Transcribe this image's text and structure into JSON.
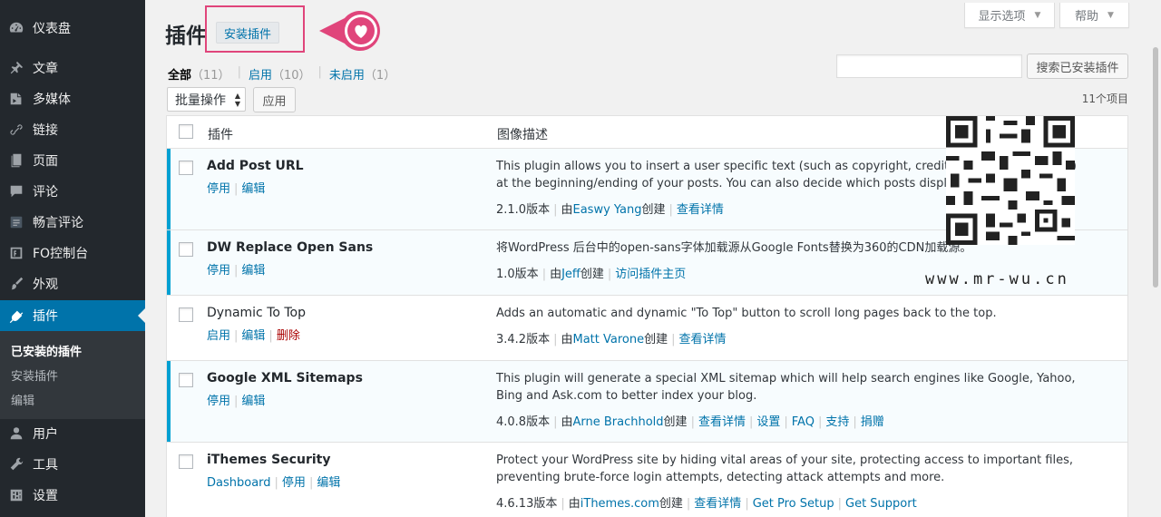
{
  "sidebar": {
    "items": [
      {
        "label": "仪表盘",
        "icon": "dashboard-icon"
      },
      {
        "label": "文章",
        "icon": "pin-icon"
      },
      {
        "label": "多媒体",
        "icon": "media-icon"
      },
      {
        "label": "链接",
        "icon": "link-icon"
      },
      {
        "label": "页面",
        "icon": "page-icon"
      },
      {
        "label": "评论",
        "icon": "comment-icon"
      },
      {
        "label": "畅言评论",
        "icon": "changyan-icon"
      },
      {
        "label": "FO控制台",
        "icon": "fo-console-icon"
      },
      {
        "label": "外观",
        "icon": "brush-icon"
      },
      {
        "label": "插件",
        "icon": "plugin-icon"
      },
      {
        "label": "用户",
        "icon": "user-icon"
      },
      {
        "label": "工具",
        "icon": "wrench-icon"
      },
      {
        "label": "设置",
        "icon": "settings-icon"
      }
    ],
    "submenu": [
      "已安装的插件",
      "安装插件",
      "编辑"
    ]
  },
  "header": {
    "title": "插件",
    "add_new": "安装插件",
    "screen_options": "显示选项",
    "help": "帮助"
  },
  "filters": {
    "all": "全部",
    "all_count": "（11）",
    "active": "启用",
    "active_count": "（10）",
    "inactive": "未启用",
    "inactive_count": "（1）"
  },
  "search": {
    "placeholder": "",
    "button": "搜索已安装插件"
  },
  "bulk": {
    "select": "批量操作",
    "apply": "应用",
    "count": "11个项目"
  },
  "table": {
    "col_plugin": "插件",
    "col_desc": "图像描述",
    "rows": [
      {
        "name": "Add Post URL",
        "actions": [
          "停用",
          "编辑"
        ],
        "desc": "This plugin allows you to insert a user specific text (such as copyright, credit, advertisement, etc.) at the beginning/ending of your posts. You can also decide which posts display the specific text.",
        "version": "2.1.0版本",
        "by": "由",
        "author": "Easwy Yang",
        "created": "创建",
        "links": [
          "查看详情"
        ]
      },
      {
        "name": "DW Replace Open Sans",
        "actions": [
          "停用",
          "编辑"
        ],
        "desc": "将WordPress 后台中的open-sans字体加载源从Google Fonts替换为360的CDN加载源。",
        "version": "1.0版本",
        "by": "由",
        "author": "Jeff",
        "created": "创建",
        "links": [
          "访问插件主页"
        ]
      },
      {
        "name": "Dynamic To Top",
        "actions": [
          "启用",
          "编辑",
          "删除"
        ],
        "desc": "Adds an automatic and dynamic \"To Top\" button to scroll long pages back to the top.",
        "version": "3.4.2版本",
        "by": "由",
        "author": "Matt Varone",
        "created": "创建",
        "links": [
          "查看详情"
        ]
      },
      {
        "name": "Google XML Sitemaps",
        "actions": [
          "停用",
          "编辑"
        ],
        "desc": "This plugin will generate a special XML sitemap which will help search engines like Google, Yahoo, Bing and Ask.com to better index your blog.",
        "version": "4.0.8版本",
        "by": "由",
        "author": "Arne Brachhold",
        "created": "创建",
        "links": [
          "查看详情",
          "设置",
          "FAQ",
          "支持",
          "捐赠"
        ]
      },
      {
        "name": "iThemes Security",
        "actions": [
          "Dashboard",
          "停用",
          "编辑"
        ],
        "desc": "Protect your WordPress site by hiding vital areas of your site, protecting access to important files, preventing brute-force login attempts, detecting attack attempts and more.",
        "version": "4.6.13版本",
        "by": "由",
        "author": "iThemes.com",
        "created": "创建",
        "links": [
          "查看详情",
          "Get Pro Setup",
          "Get Support"
        ]
      }
    ]
  },
  "watermark": {
    "url": "www.mr-wu.cn"
  },
  "colors": {
    "sidebar_bg": "#23282d",
    "active_menu": "#0073aa",
    "active_row_border": "#00a0d2",
    "link": "#0073aa",
    "delete": "#aa0000",
    "highlight": "#e0457b"
  }
}
